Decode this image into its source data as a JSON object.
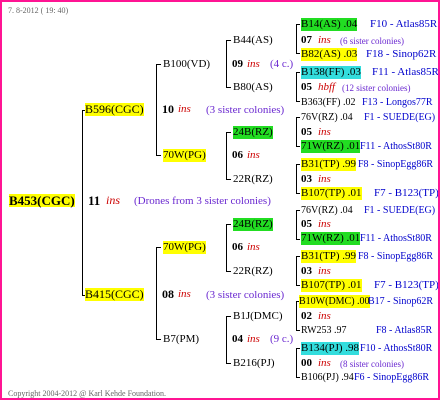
{
  "header": {
    "date": "7. 8-2012 ( 19: 40)"
  },
  "footer": {
    "copyright": "Copyright 2004-2012 @ Karl Kehde Foundation."
  },
  "root": {
    "id": "B453(CGC)",
    "gen": "11",
    "ins": "ins",
    "note": "(Drones from 3 sister colonies)"
  },
  "sire": {
    "id": "B596(CGC)",
    "gen": "10",
    "ins": "ins",
    "note": "(3 sister colonies)",
    "a": {
      "id": "B100(VD)",
      "gen": "09",
      "ins": "ins",
      "note": "(4 c.)",
      "a": {
        "id": "B44(AS)",
        "l1": "B14(AS) .04",
        "l1r": "F10 - Atlas85R",
        "gen": "07",
        "ins": "ins",
        "note": "(6 sister colonies)",
        "l2": "B82(AS) .03",
        "l2r": "F18 - Sinop62R"
      },
      "b": {
        "id": "B80(AS)",
        "l1": "B138(FF) .03",
        "l1r": "F11 - Atlas85R",
        "gen": "05",
        "ins": "hbff",
        "note": "(12 sister colonies)",
        "l2": "B363(FF) .02",
        "l2r": "F13 - Longos77R"
      }
    },
    "b": {
      "id": "70W(PG)",
      "gen": "06",
      "ins": "ins",
      "a": {
        "id": "24B(RZ)",
        "l1": "76V(RZ) .04",
        "l1r": "F1 - SUEDE(EG)",
        "gen": "05",
        "ins": "ins",
        "l2": "71W(RZ) .01",
        "l2r": "F11 - AthosSt80R"
      },
      "b": {
        "id": "22R(RZ)",
        "l1": "B31(TP) .99",
        "l1r": "F8 - SinopEgg86R",
        "gen": "03",
        "ins": "ins",
        "l2": "B107(TP) .01",
        "l2r": "F7 - B123(TP)"
      }
    }
  },
  "dam": {
    "id": "B415(CGC)",
    "gen": "08",
    "ins": "ins",
    "note": "(3 sister colonies)",
    "a": {
      "id": "70W(PG)",
      "gen": "06",
      "ins": "ins",
      "a": {
        "id": "24B(RZ)",
        "l1": "76V(RZ) .04",
        "l1r": "F1 - SUEDE(EG)",
        "gen": "05",
        "ins": "ins",
        "l2": "71W(RZ) .01",
        "l2r": "F11 - AthosSt80R"
      },
      "b": {
        "id": "22R(RZ)",
        "l1": "B31(TP) .99",
        "l1r": "F8 - SinopEgg86R",
        "gen": "03",
        "ins": "ins",
        "l2": "B107(TP) .01",
        "l2r": "F7 - B123(TP)"
      }
    },
    "b": {
      "id": "B7(PM)",
      "gen": "04",
      "ins": "ins",
      "note": "(9 c.)",
      "a": {
        "id": "B1J(DMC)",
        "l1": "B10W(DMC) .00",
        "l1r": "B17 - Sinop62R",
        "gen": "02",
        "ins": "ins",
        "l2": "RW253 .97",
        "l2r": "F8 - Atlas85R"
      },
      "b": {
        "id": "B216(PJ)",
        "l1": "B134(PJ) .98",
        "l1r": "F10 - AthosSt80R",
        "gen": "00",
        "ins": "ins",
        "note": "(8 sister colonies)",
        "l2": "B106(PJ) .94",
        "l2r": "F6 - SinopEgg86R"
      }
    }
  }
}
